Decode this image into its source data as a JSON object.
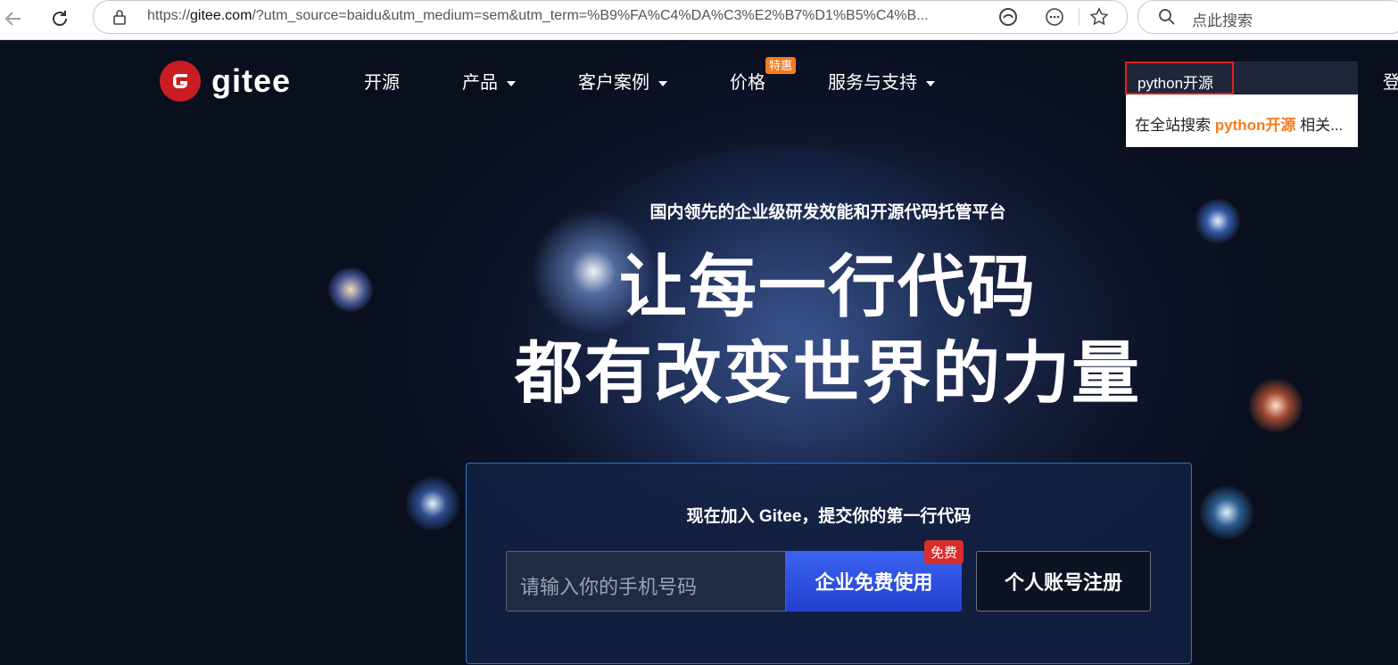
{
  "browser": {
    "url_prefix": "https://",
    "url_host": "gitee.com",
    "url_rest": "/?utm_source=baidu&utm_medium=sem&utm_term=%B9%FA%C4%DA%C3%E2%B7%D1%B5%C4%B...",
    "search_placeholder": "点此搜索"
  },
  "header": {
    "logo_text": "gitee",
    "nav": {
      "open_source": "开源",
      "products": "产品",
      "cases": "客户案例",
      "pricing": "价格",
      "pricing_badge": "特惠",
      "support": "服务与支持",
      "login_partial": "登"
    },
    "search": {
      "value": "python开源",
      "dropdown_prefix": "在全站搜索 ",
      "dropdown_keyword": "python开源",
      "dropdown_suffix": " 相关..."
    }
  },
  "hero": {
    "subtitle": "国内领先的企业级研发效能和开源代码托管平台",
    "line1": "让每一行代码",
    "line2": "都有改变世界的力量"
  },
  "signup": {
    "title": "现在加入 Gitee，提交你的第一行代码",
    "phone_placeholder": "请输入你的手机号码",
    "enterprise_button": "企业免费使用",
    "free_badge": "免费",
    "personal_button": "个人账号注册"
  },
  "colors": {
    "brand_red": "#c71d23",
    "accent_orange": "#f57c1f",
    "primary_blue": "#2f54eb"
  }
}
